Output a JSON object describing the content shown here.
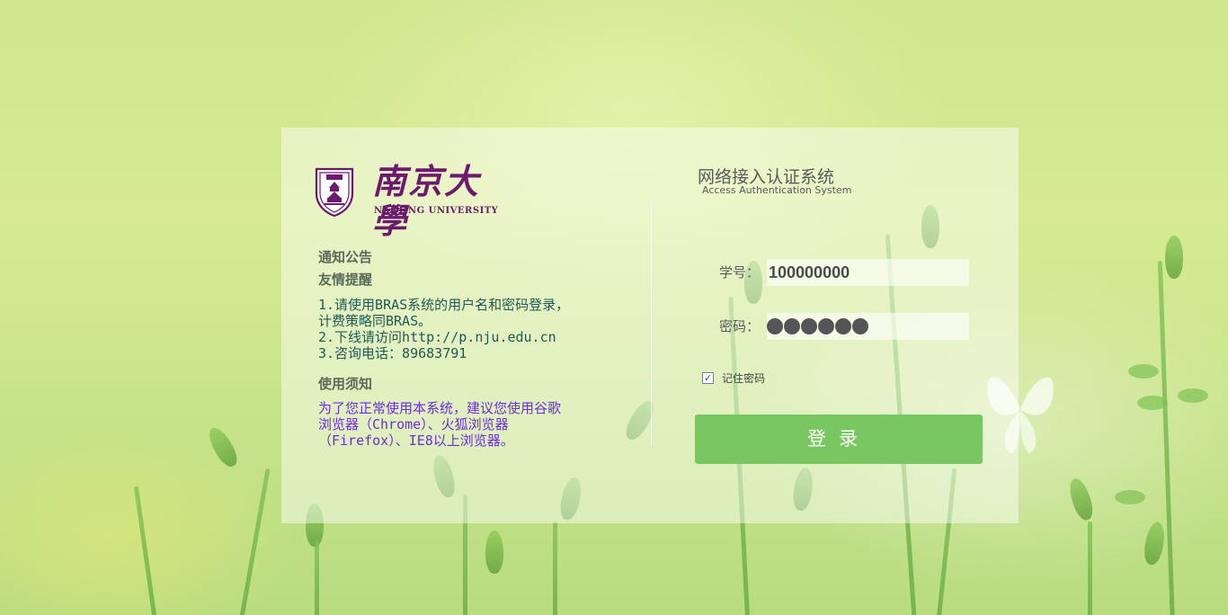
{
  "logo": {
    "chinese_name": "南京大學",
    "english_name": "NANJING UNIVERSITY"
  },
  "notice": {
    "heading": "通知公告",
    "reminder_heading": "友情提醒",
    "reminder_lines": [
      "1.请使用BRAS系统的用户名和密码登录，",
      "计费策略同BRAS。",
      "2.下线请访问http://p.nju.edu.cn",
      "3.咨询电话：89683791"
    ],
    "usage_heading": "使用须知",
    "usage_lines": [
      "为了您正常使用本系统，建议您使用谷歌",
      "浏览器（Chrome）、火狐浏览器",
      "（Firefox）、IE8以上浏览器。"
    ]
  },
  "system": {
    "title": "网络接入认证系统",
    "subtitle": "Access Authentication System"
  },
  "form": {
    "username_label": "学号：",
    "username_value": "100000000",
    "password_label": "密码：",
    "password_masked_count": 6,
    "remember_label": "记住密码",
    "remember_checked": true,
    "login_label": "登录"
  },
  "colors": {
    "brand_purple": "#6b1a6e",
    "button_green": "#79c760",
    "reminder_text": "#1f5a55",
    "usage_text": "#6a2fe0"
  }
}
